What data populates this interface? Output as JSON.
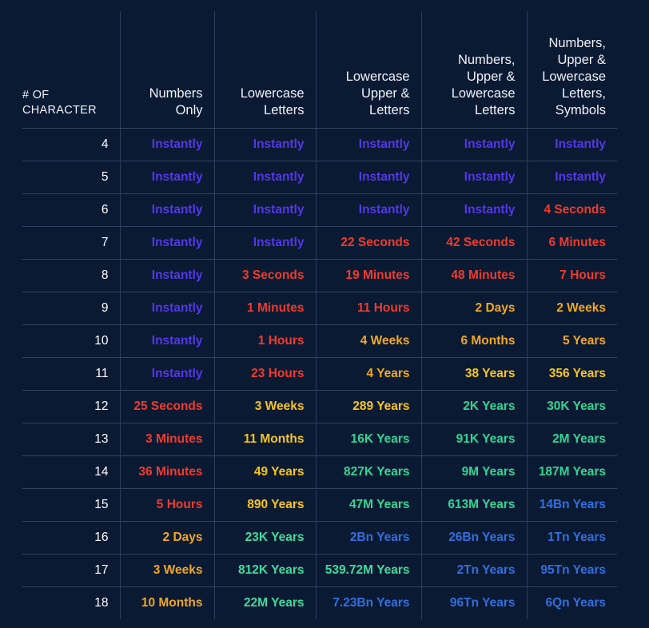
{
  "table": {
    "columns": [
      "# OF\nCHARACTER",
      "Numbers\nOnly",
      "Lowercase\nLetters",
      "Lowercase\nUpper &\nLetters",
      "Numbers,\nUpper &\nLowercase\nLetters",
      "Numbers,\nUpper &\nLowercase\nLetters,\nSymbols"
    ],
    "columns_lines": [
      [
        "# OF",
        "CHARACTER"
      ],
      [
        "Numbers",
        "Only"
      ],
      [
        "Lowercase",
        "Letters"
      ],
      [
        "Lowercase",
        "Upper &",
        "Letters"
      ],
      [
        "Numbers,",
        "Upper &",
        "Lowercase",
        "Letters"
      ],
      [
        "Numbers,",
        "Upper &",
        "Lowercase",
        "Letters,",
        "Symbols"
      ]
    ],
    "rows": [
      {
        "chars": "4",
        "cells": [
          {
            "text": "Instantly",
            "tier": "purple"
          },
          {
            "text": "Instantly",
            "tier": "purple"
          },
          {
            "text": "Instantly",
            "tier": "purple"
          },
          {
            "text": "Instantly",
            "tier": "purple"
          },
          {
            "text": "Instantly",
            "tier": "purple"
          }
        ]
      },
      {
        "chars": "5",
        "cells": [
          {
            "text": "Instantly",
            "tier": "purple"
          },
          {
            "text": "Instantly",
            "tier": "purple"
          },
          {
            "text": "Instantly",
            "tier": "purple"
          },
          {
            "text": "Instantly",
            "tier": "purple"
          },
          {
            "text": "Instantly",
            "tier": "purple"
          }
        ]
      },
      {
        "chars": "6",
        "cells": [
          {
            "text": "Instantly",
            "tier": "purple"
          },
          {
            "text": "Instantly",
            "tier": "purple"
          },
          {
            "text": "Instantly",
            "tier": "purple"
          },
          {
            "text": "Instantly",
            "tier": "purple"
          },
          {
            "text": "4 Seconds",
            "tier": "red"
          }
        ]
      },
      {
        "chars": "7",
        "cells": [
          {
            "text": "Instantly",
            "tier": "purple"
          },
          {
            "text": "Instantly",
            "tier": "purple"
          },
          {
            "text": "22 Seconds",
            "tier": "red"
          },
          {
            "text": "42 Seconds",
            "tier": "red"
          },
          {
            "text": "6 Minutes",
            "tier": "red"
          }
        ]
      },
      {
        "chars": "8",
        "cells": [
          {
            "text": "Instantly",
            "tier": "purple"
          },
          {
            "text": "3 Seconds",
            "tier": "red"
          },
          {
            "text": "19 Minutes",
            "tier": "red"
          },
          {
            "text": "48 Minutes",
            "tier": "red"
          },
          {
            "text": "7 Hours",
            "tier": "red"
          }
        ]
      },
      {
        "chars": "9",
        "cells": [
          {
            "text": "Instantly",
            "tier": "purple"
          },
          {
            "text": "1 Minutes",
            "tier": "red"
          },
          {
            "text": "11 Hours",
            "tier": "red"
          },
          {
            "text": "2 Days",
            "tier": "orange"
          },
          {
            "text": "2 Weeks",
            "tier": "orange"
          }
        ]
      },
      {
        "chars": "10",
        "cells": [
          {
            "text": "Instantly",
            "tier": "purple"
          },
          {
            "text": "1 Hours",
            "tier": "red"
          },
          {
            "text": "4 Weeks",
            "tier": "orange"
          },
          {
            "text": "6 Months",
            "tier": "orange"
          },
          {
            "text": "5 Years",
            "tier": "orange"
          }
        ]
      },
      {
        "chars": "11",
        "cells": [
          {
            "text": "Instantly",
            "tier": "purple"
          },
          {
            "text": "23 Hours",
            "tier": "red"
          },
          {
            "text": "4 Years",
            "tier": "orange"
          },
          {
            "text": "38 Years",
            "tier": "gold"
          },
          {
            "text": "356 Years",
            "tier": "gold"
          }
        ]
      },
      {
        "chars": "12",
        "cells": [
          {
            "text": "25 Seconds",
            "tier": "red"
          },
          {
            "text": "3 Weeks",
            "tier": "gold"
          },
          {
            "text": "289 Years",
            "tier": "gold"
          },
          {
            "text": "2K Years",
            "tier": "green"
          },
          {
            "text": "30K Years",
            "tier": "green"
          }
        ]
      },
      {
        "chars": "13",
        "cells": [
          {
            "text": "3 Minutes",
            "tier": "red"
          },
          {
            "text": "11 Months",
            "tier": "gold"
          },
          {
            "text": "16K Years",
            "tier": "green"
          },
          {
            "text": "91K Years",
            "tier": "green"
          },
          {
            "text": "2M Years",
            "tier": "green"
          }
        ]
      },
      {
        "chars": "14",
        "cells": [
          {
            "text": "36 Minutes",
            "tier": "red"
          },
          {
            "text": "49 Years",
            "tier": "gold"
          },
          {
            "text": "827K Years",
            "tier": "green"
          },
          {
            "text": "9M Years",
            "tier": "green"
          },
          {
            "text": "187M Years",
            "tier": "green"
          }
        ]
      },
      {
        "chars": "15",
        "cells": [
          {
            "text": "5 Hours",
            "tier": "red"
          },
          {
            "text": "890 Years",
            "tier": "gold"
          },
          {
            "text": "47M Years",
            "tier": "green"
          },
          {
            "text": "613M Years",
            "tier": "green"
          },
          {
            "text": "14Bn Years",
            "tier": "blue"
          }
        ]
      },
      {
        "chars": "16",
        "cells": [
          {
            "text": "2 Days",
            "tier": "orange"
          },
          {
            "text": "23K Years",
            "tier": "mint"
          },
          {
            "text": "2Bn Years",
            "tier": "blue"
          },
          {
            "text": "26Bn Years",
            "tier": "blue"
          },
          {
            "text": "1Tn Years",
            "tier": "blue"
          }
        ]
      },
      {
        "chars": "17",
        "cells": [
          {
            "text": "3 Weeks",
            "tier": "orange"
          },
          {
            "text": "812K Years",
            "tier": "mint"
          },
          {
            "text": "539.72M Years",
            "tier": "mint"
          },
          {
            "text": "2Tn Years",
            "tier": "blue"
          },
          {
            "text": "95Tn Years",
            "tier": "blue"
          }
        ]
      },
      {
        "chars": "18",
        "cells": [
          {
            "text": "10 Months",
            "tier": "orange"
          },
          {
            "text": "22M Years",
            "tier": "mint"
          },
          {
            "text": "7.23Bn Years",
            "tier": "blue"
          },
          {
            "text": "96Tn Years",
            "tier": "blue"
          },
          {
            "text": "6Qn Years",
            "tier": "blue"
          }
        ]
      }
    ]
  },
  "colors": {
    "background": "#0b1a33",
    "grid": "#2b3d5c",
    "header_text": "#eef2f7",
    "index_text": "#ffffff",
    "tier_purple": "#5138e8",
    "tier_red": "#ef3b2d",
    "tier_orange": "#f0a81e",
    "tier_gold": "#f5c518",
    "tier_green": "#2fd693",
    "tier_mint": "#3ddc9b",
    "tier_blue": "#2f6fe0"
  }
}
